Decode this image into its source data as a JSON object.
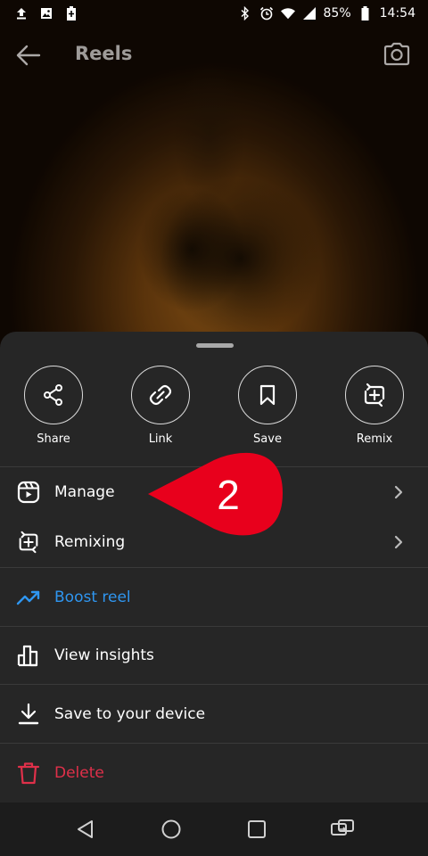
{
  "status_bar": {
    "battery": "85%",
    "time": "14:54",
    "icons": [
      "upload-icon",
      "image-icon",
      "battery-saver-icon",
      "bluetooth-icon",
      "alarm-icon",
      "wifi-icon",
      "signal-icon"
    ]
  },
  "app_bar": {
    "title": "Reels",
    "back_icon": "arrow-left-icon",
    "camera_icon": "camera-icon"
  },
  "actions": [
    {
      "label": "Share",
      "icon": "share-icon"
    },
    {
      "label": "Link",
      "icon": "link-icon"
    },
    {
      "label": "Save",
      "icon": "bookmark-icon"
    },
    {
      "label": "Remix",
      "icon": "remix-icon"
    }
  ],
  "menu": [
    {
      "label": "Manage",
      "icon": "reel-manage-icon",
      "chevron": true
    },
    {
      "label": "Remixing",
      "icon": "remix-icon",
      "chevron": true
    },
    {
      "label": "Boost reel",
      "icon": "trending-up-icon",
      "color": "#2f96f0"
    },
    {
      "label": "View insights",
      "icon": "bar-chart-icon"
    },
    {
      "label": "Save to your device",
      "icon": "download-icon"
    },
    {
      "label": "Delete",
      "icon": "trash-icon",
      "color": "#e0304a"
    }
  ],
  "annotation": {
    "text": "2",
    "color": "#e8001c"
  },
  "nav_bar": [
    "back-triangle-icon",
    "home-circle-icon",
    "recents-square-icon",
    "switch-apps-icon"
  ]
}
